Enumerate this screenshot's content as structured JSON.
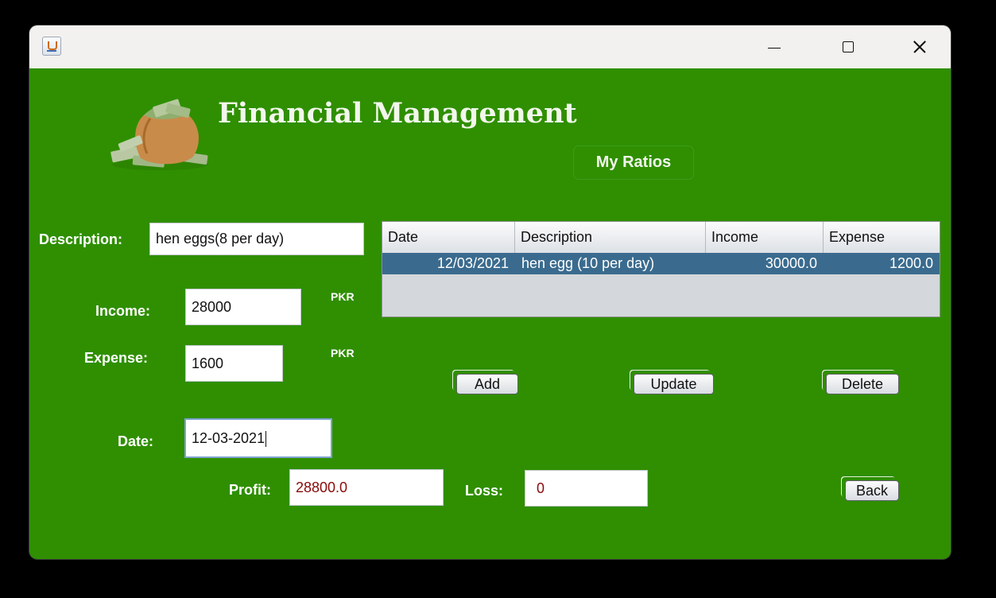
{
  "window": {
    "title": ""
  },
  "header": {
    "title": "Financial Management",
    "ratios_button": "My Ratios"
  },
  "form": {
    "description_label": "Description:",
    "description_value": "hen eggs(8 per day)",
    "income_label": "Income:",
    "income_value": "28000",
    "income_unit": "PKR",
    "expense_label": "Expense:",
    "expense_value": "1600",
    "expense_unit": "PKR",
    "date_label": "Date:",
    "date_value": "12-03-2021",
    "profit_label": "Profit:",
    "profit_value": "28800.0",
    "loss_label": "Loss:",
    "loss_value": "0"
  },
  "table": {
    "columns": [
      "Date",
      "Description",
      "Income",
      "Expense"
    ],
    "rows": [
      [
        "12/03/2021",
        "hen egg (10 per day)",
        "30000.0",
        "1200.0"
      ]
    ]
  },
  "buttons": {
    "add": "Add",
    "update": "Update",
    "delete": "Delete",
    "back": "Back"
  },
  "colors": {
    "background": "#2f8f00",
    "selected_row": "#3a6b8e",
    "result_text": "#8a0a0a"
  }
}
